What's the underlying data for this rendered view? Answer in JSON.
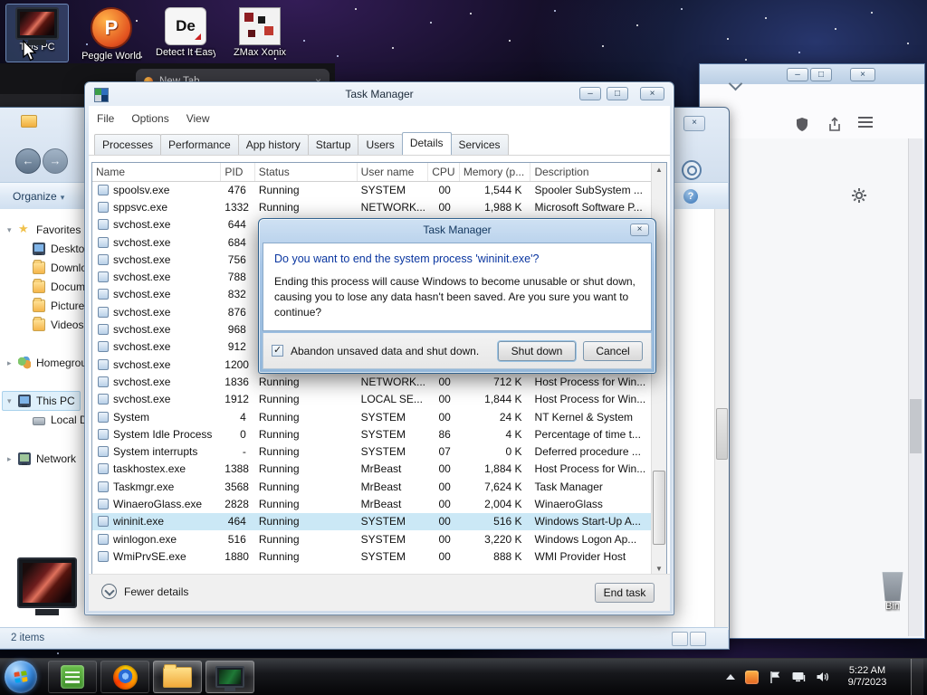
{
  "desktop": {
    "icons": [
      {
        "label": "This PC",
        "icon": "computer-monitor",
        "selected": true
      },
      {
        "label": "Peggle World",
        "icon": "peggle",
        "glyph": "P",
        "selected": false
      },
      {
        "label": "Detect It Easy",
        "icon": "detect-it-easy",
        "glyph": "De",
        "selected": false
      },
      {
        "label": "ZMax Xonix",
        "icon": "zmax-xonix",
        "selected": false
      }
    ],
    "recycle_bin": {
      "label": "Bin"
    }
  },
  "firefox": {
    "tab_title": "New Tab"
  },
  "explorer": {
    "organize_label": "Organize",
    "sidebar": [
      {
        "label": "Favorites",
        "icon": "star"
      },
      {
        "label": "Desktop",
        "icon": "monitor"
      },
      {
        "label": "Downloads",
        "icon": "folder"
      },
      {
        "label": "Documents",
        "icon": "folder"
      },
      {
        "label": "Pictures",
        "icon": "folder"
      },
      {
        "label": "Videos",
        "icon": "folder"
      },
      {
        "label": "Homegroup",
        "icon": "homegroup"
      },
      {
        "label": "This PC",
        "icon": "computer",
        "current": true
      },
      {
        "label": "Local Disk",
        "icon": "disk"
      },
      {
        "label": "Network",
        "icon": "network"
      }
    ],
    "status_text": "2 items"
  },
  "task_manager": {
    "title": "Task Manager",
    "menu": [
      "File",
      "Options",
      "View"
    ],
    "tabs": [
      "Processes",
      "Performance",
      "App history",
      "Startup",
      "Users",
      "Details",
      "Services"
    ],
    "active_tab": "Details",
    "columns": [
      "Name",
      "PID",
      "Status",
      "User name",
      "CPU",
      "Memory (p...",
      "Description"
    ],
    "rows": [
      [
        "spoolsv.exe",
        "476",
        "Running",
        "SYSTEM",
        "00",
        "1,544 K",
        "Spooler SubSystem ..."
      ],
      [
        "sppsvc.exe",
        "1332",
        "Running",
        "NETWORK...",
        "00",
        "1,988 K",
        "Microsoft Software P..."
      ],
      [
        "svchost.exe",
        "644",
        "",
        "",
        "",
        "",
        ""
      ],
      [
        "svchost.exe",
        "684",
        "",
        "",
        "",
        "",
        ""
      ],
      [
        "svchost.exe",
        "756",
        "",
        "",
        "",
        "",
        ""
      ],
      [
        "svchost.exe",
        "788",
        "",
        "",
        "",
        "",
        ""
      ],
      [
        "svchost.exe",
        "832",
        "",
        "",
        "",
        "",
        ""
      ],
      [
        "svchost.exe",
        "876",
        "",
        "",
        "",
        "",
        ""
      ],
      [
        "svchost.exe",
        "968",
        "",
        "",
        "",
        "",
        ""
      ],
      [
        "svchost.exe",
        "912",
        "",
        "",
        "",
        "",
        ""
      ],
      [
        "svchost.exe",
        "1200",
        "",
        "",
        "",
        "",
        ""
      ],
      [
        "svchost.exe",
        "1836",
        "Running",
        "NETWORK...",
        "00",
        "712 K",
        "Host Process for Win..."
      ],
      [
        "svchost.exe",
        "1912",
        "Running",
        "LOCAL SE...",
        "00",
        "1,844 K",
        "Host Process for Win..."
      ],
      [
        "System",
        "4",
        "Running",
        "SYSTEM",
        "00",
        "24 K",
        "NT Kernel & System"
      ],
      [
        "System Idle Process",
        "0",
        "Running",
        "SYSTEM",
        "86",
        "4 K",
        "Percentage of time t..."
      ],
      [
        "System interrupts",
        "-",
        "Running",
        "SYSTEM",
        "07",
        "0 K",
        "Deferred procedure ..."
      ],
      [
        "taskhostex.exe",
        "1388",
        "Running",
        "MrBeast",
        "00",
        "1,884 K",
        "Host Process for Win..."
      ],
      [
        "Taskmgr.exe",
        "3568",
        "Running",
        "MrBeast",
        "00",
        "7,624 K",
        "Task Manager"
      ],
      [
        "WinaeroGlass.exe",
        "2828",
        "Running",
        "MrBeast",
        "00",
        "2,004 K",
        "WinaeroGlass"
      ],
      [
        "wininit.exe",
        "464",
        "Running",
        "SYSTEM",
        "00",
        "516 K",
        "Windows Start-Up A..."
      ],
      [
        "winlogon.exe",
        "516",
        "Running",
        "SYSTEM",
        "00",
        "3,220 K",
        "Windows Logon Ap..."
      ],
      [
        "WmiPrvSE.exe",
        "1880",
        "Running",
        "SYSTEM",
        "00",
        "888 K",
        "WMI Provider Host"
      ]
    ],
    "selected_row": "wininit.exe",
    "footer": {
      "fewer_details": "Fewer details",
      "end_task": "End task"
    }
  },
  "dialog": {
    "title": "Task Manager",
    "question": "Do you want to end the system process 'wininit.exe'?",
    "body": "Ending this process will cause Windows to become unusable or shut down, causing you to lose any data hasn't been saved. Are you sure you want to continue?",
    "checkbox": {
      "label": "Abandon unsaved data and shut down.",
      "checked": true
    },
    "buttons": [
      {
        "label": "Shut down"
      },
      {
        "label": "Cancel"
      }
    ]
  },
  "taskbar": {
    "buttons": [
      {
        "icon": "notes-app",
        "active": false
      },
      {
        "icon": "firefox",
        "active": false
      },
      {
        "icon": "file-explorer",
        "active": true
      },
      {
        "icon": "task-manager",
        "active": true
      }
    ],
    "clock": {
      "time": "5:22 AM",
      "date": "9/7/2023"
    }
  }
}
